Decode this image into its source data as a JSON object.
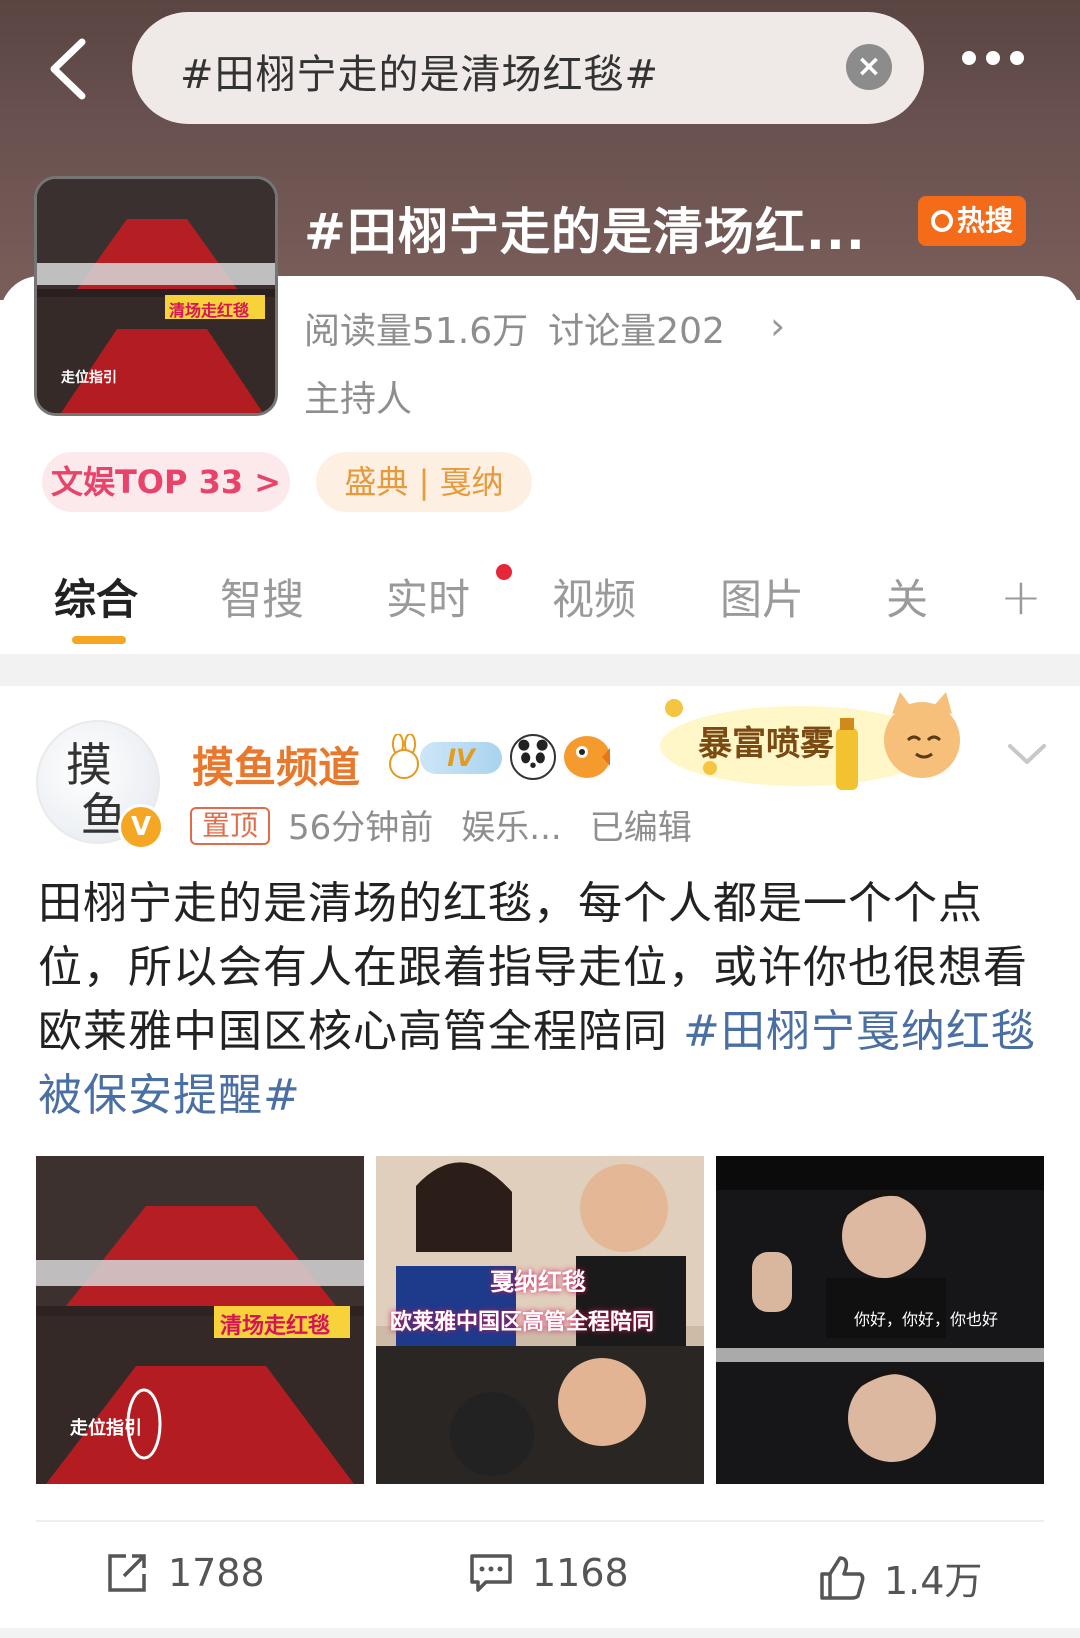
{
  "header": {
    "search_query": "#田栩宁走的是清场红毯#",
    "topic_title": "#田栩宁走的是清场红...",
    "hot_badge": "热搜",
    "thumb_caption_1": "清场走红毯",
    "thumb_caption_2": "走位指引"
  },
  "topic": {
    "reads": "阅读量51.6万",
    "discussions": "讨论量202",
    "host": "主持人",
    "tag_rank": "文娱TOP 33 >",
    "tag_event": "盛典 | 戛纳"
  },
  "tabs": [
    "综合",
    "智搜",
    "实时",
    "视频",
    "图片",
    "关"
  ],
  "post": {
    "author": "摸鱼频道",
    "avatar_text": "摸\n鱼",
    "iv_badge": "IV",
    "sticker_text": "暴富喷雾",
    "pinned": "置顶",
    "time": "56分钟前",
    "source": "娱乐...",
    "edited": "已编辑",
    "body_text": "田栩宁走的是清场的红毯，每个人都是一个个点位，所以会有人在跟着指导走位，或许你也很想看欧莱雅中国区核心高管全程陪同",
    "hashtag": "#田栩宁戛纳红毯被保安提醒#",
    "photo_1_caption_a": "清场走红毯",
    "photo_1_caption_b": "走位指引",
    "photo_2_caption_a": "戛纳红毯",
    "photo_2_caption_b": "欧莱雅中国区高管全程陪同",
    "photo_3_caption": "你好，你好，你也好",
    "reposts": "1788",
    "comments": "1168",
    "likes": "1.4万"
  },
  "colors": {
    "header_bg": "#6a5250",
    "accent_orange": "#f5a623",
    "author_orange": "#e8782b",
    "hashtag_blue": "#4a6fa5",
    "hot_badge": "#f46b1a"
  },
  "icons": [
    "back-arrow-icon",
    "clear-icon",
    "more-icon",
    "chevron-right-icon",
    "plus-icon",
    "chevron-down-icon",
    "verified-icon",
    "repost-icon",
    "comment-icon",
    "like-icon"
  ]
}
